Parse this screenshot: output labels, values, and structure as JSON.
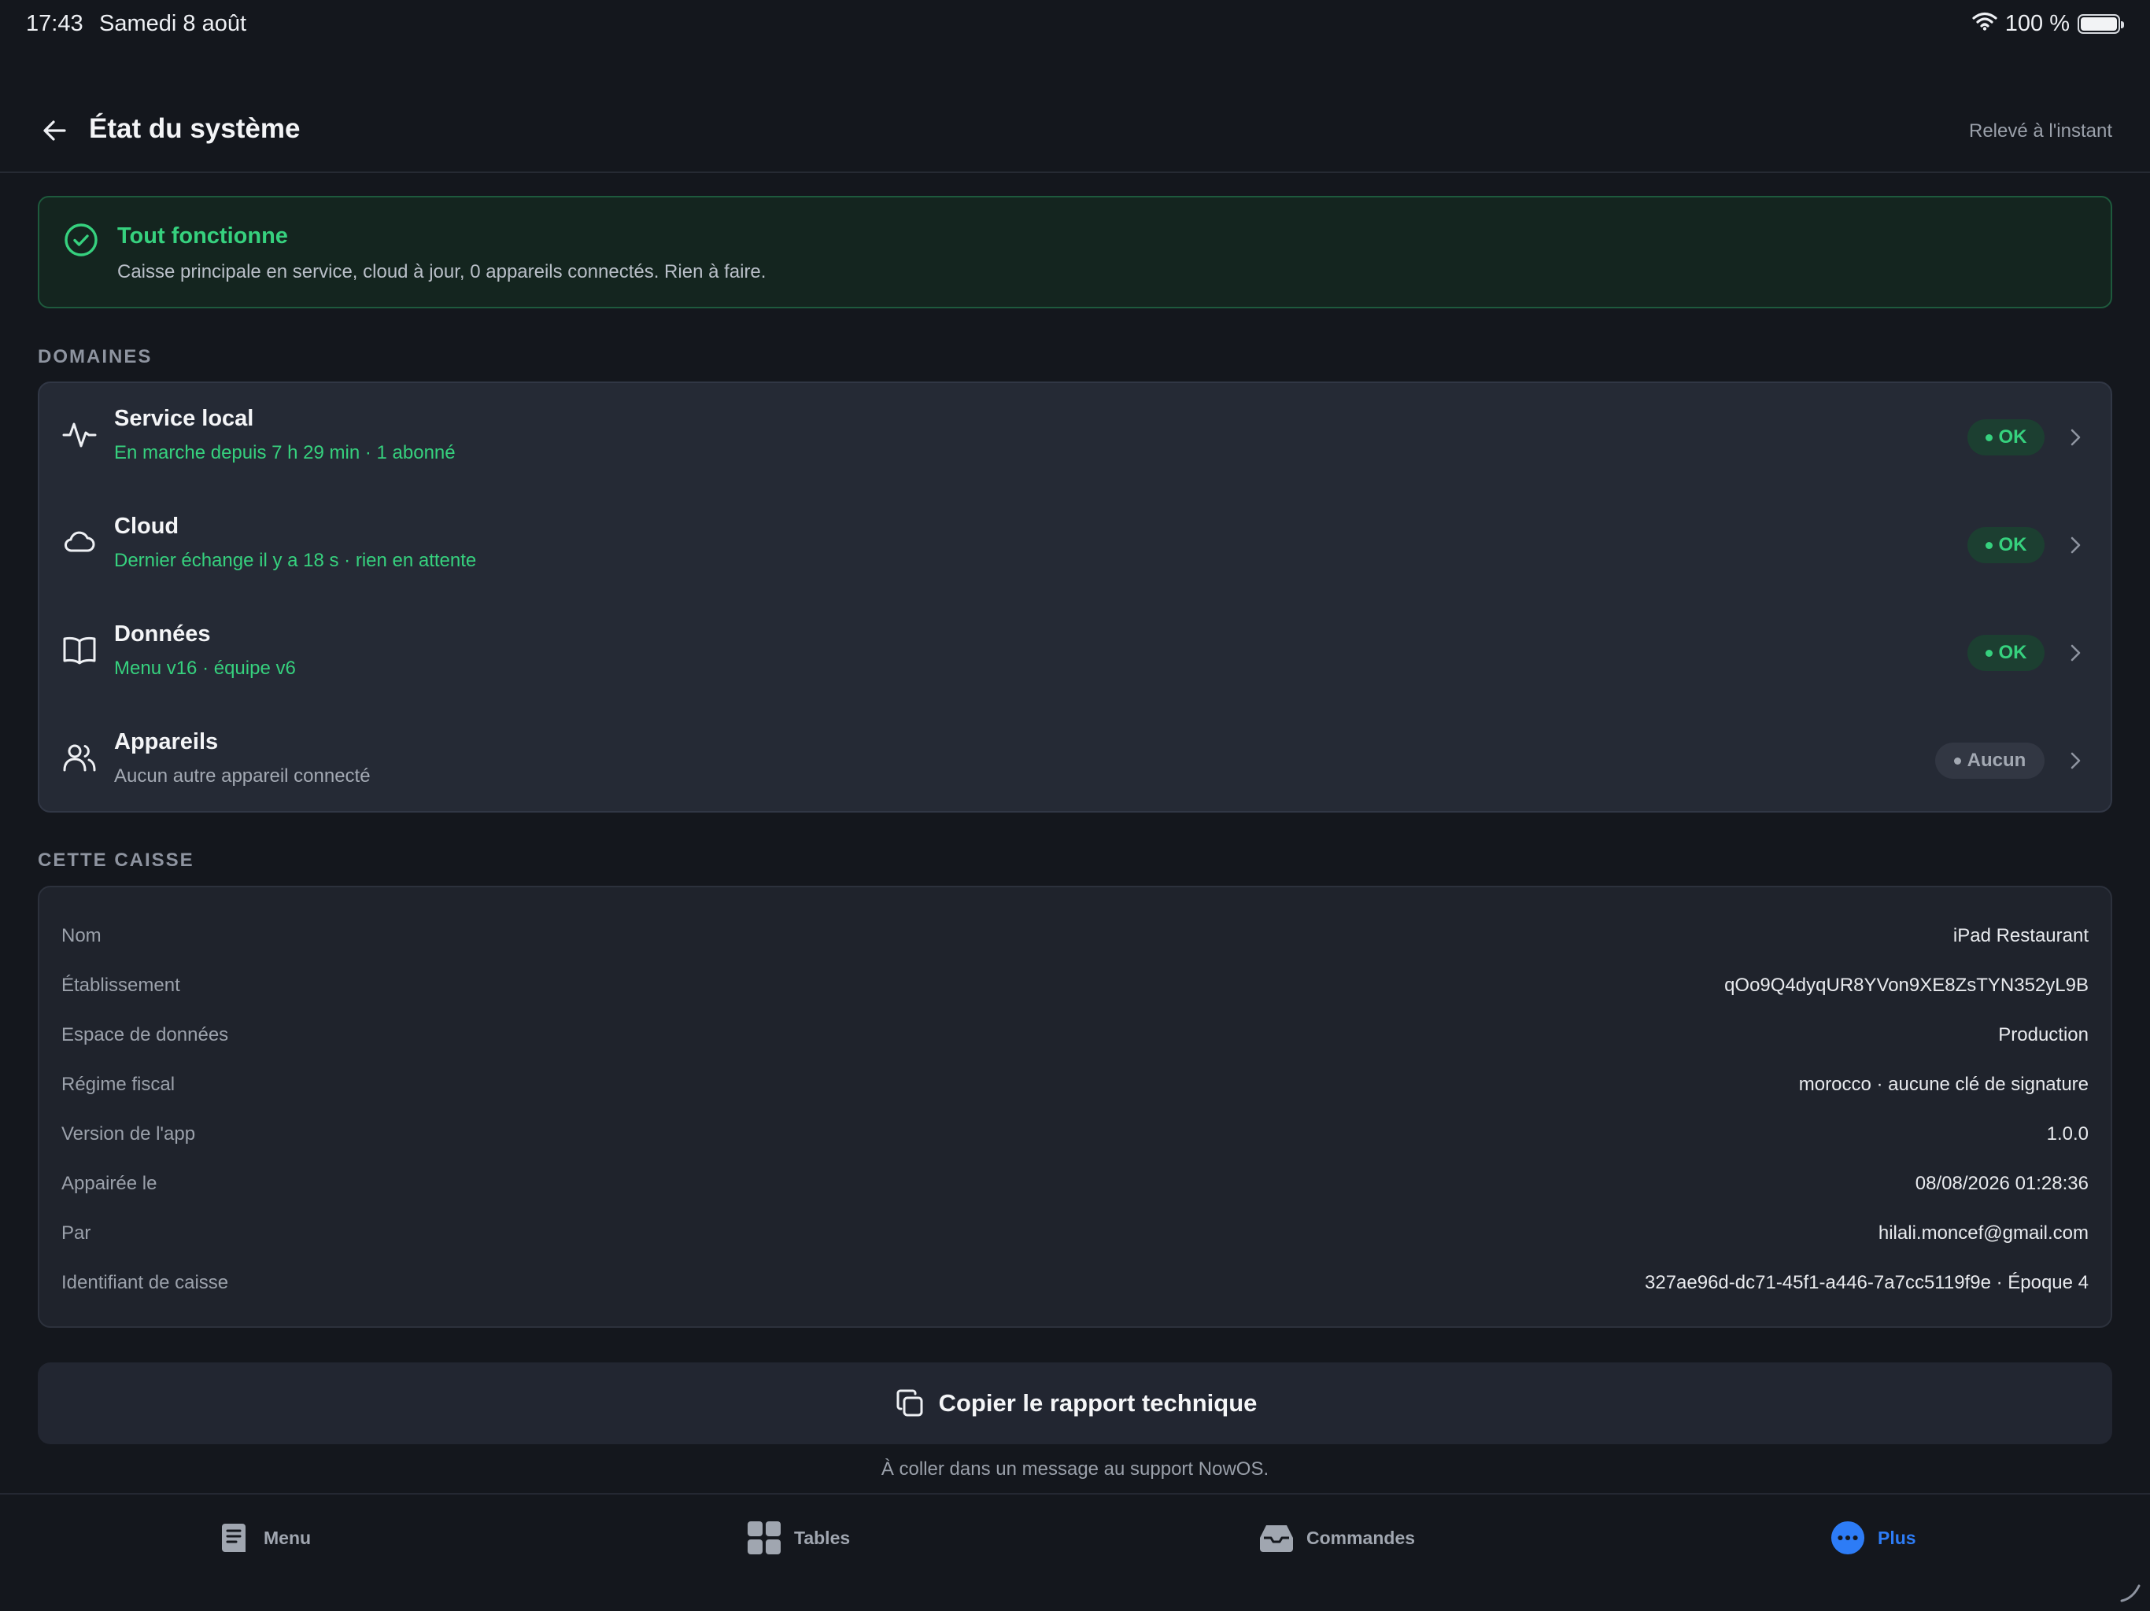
{
  "status_bar": {
    "time": "17:43",
    "date": "Samedi 8 août",
    "battery": "100 %"
  },
  "header": {
    "title": "État du système",
    "meta": "Relevé à l'instant"
  },
  "banner": {
    "title": "Tout fonctionne",
    "text": "Caisse principale en service, cloud à jour, 0 appareils connectés. Rien à faire."
  },
  "sections": {
    "domains": "DOMAINES",
    "this_register": "CETTE CAISSE"
  },
  "domains": [
    {
      "icon": "activity-icon",
      "title": "Service local",
      "subtitle": "En marche depuis 7 h 29 min · 1 abonné",
      "status": "OK"
    },
    {
      "icon": "cloud-icon",
      "title": "Cloud",
      "subtitle": "Dernier échange il y a 18 s · rien en attente",
      "status": "OK"
    },
    {
      "icon": "book-icon",
      "title": "Données",
      "subtitle": "Menu v16 · équipe v6",
      "status": "OK"
    },
    {
      "icon": "users-icon",
      "title": "Appareils",
      "subtitle": "Aucun autre appareil connecté",
      "status": "Aucun"
    }
  ],
  "register_info": [
    {
      "label": "Nom",
      "value": "iPad Restaurant"
    },
    {
      "label": "Établissement",
      "value": "qOo9Q4dyqUR8YVon9XE8ZsTYN352yL9B"
    },
    {
      "label": "Espace de données",
      "value": "Production"
    },
    {
      "label": "Régime fiscal",
      "value": "morocco · aucune clé de signature"
    },
    {
      "label": "Version de l'app",
      "value": "1.0.0"
    },
    {
      "label": "Appairée le",
      "value": "08/08/2026 01:28:36"
    },
    {
      "label": "Par",
      "value": "hilali.moncef@gmail.com"
    },
    {
      "label": "Identifiant de caisse",
      "value": "327ae96d-dc71-45f1-a446-7a7cc5119f9e · Époque 4"
    }
  ],
  "copy_report": {
    "label": "Copier le rapport technique",
    "hint": "À coller dans un message au support NowOS."
  },
  "tabs": [
    {
      "icon": "menu-card-icon",
      "label": "Menu"
    },
    {
      "icon": "tables-grid-icon",
      "label": "Tables"
    },
    {
      "icon": "tray-icon",
      "label": "Commandes"
    },
    {
      "icon": "more-icon",
      "label": "Plus",
      "active": true
    }
  ],
  "colors": {
    "background": "#14171d",
    "accent_green": "#36d17e",
    "accent_blue": "#2d7cf6",
    "card": "#252a35"
  }
}
